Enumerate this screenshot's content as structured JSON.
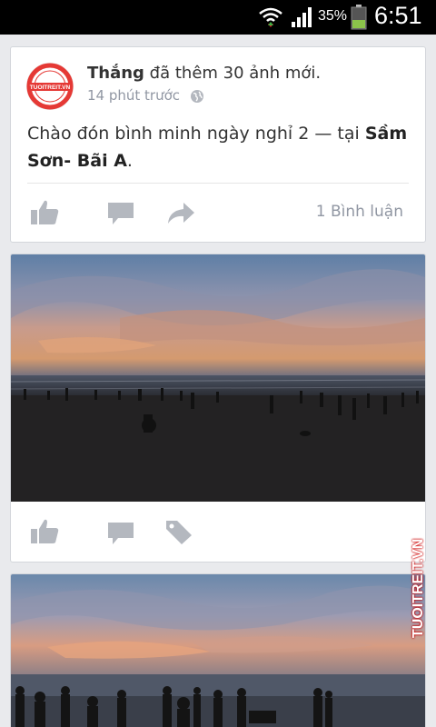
{
  "status_bar": {
    "battery_percent": "35%",
    "time": "6:51",
    "icons": [
      "wifi-icon",
      "signal-icon",
      "battery-icon"
    ]
  },
  "post": {
    "author": "Thắng",
    "action": " đã thêm 30 ảnh mới.",
    "time_ago": "14 phút trước",
    "text_before": "Chào đón bình minh ngày nghỉ 2 — tại ",
    "location": "Sầm Sơn- Bãi A",
    "text_after": ".",
    "avatar_text": "TUOITREIT.VN",
    "comments_count": "1 Bình luận"
  },
  "photos": {
    "watermark": "TUOITREIT.VN"
  },
  "colors": {
    "background": "#e9eaed",
    "text": "#333333",
    "meta": "#9197a3",
    "icon": "#b4b8bf"
  }
}
